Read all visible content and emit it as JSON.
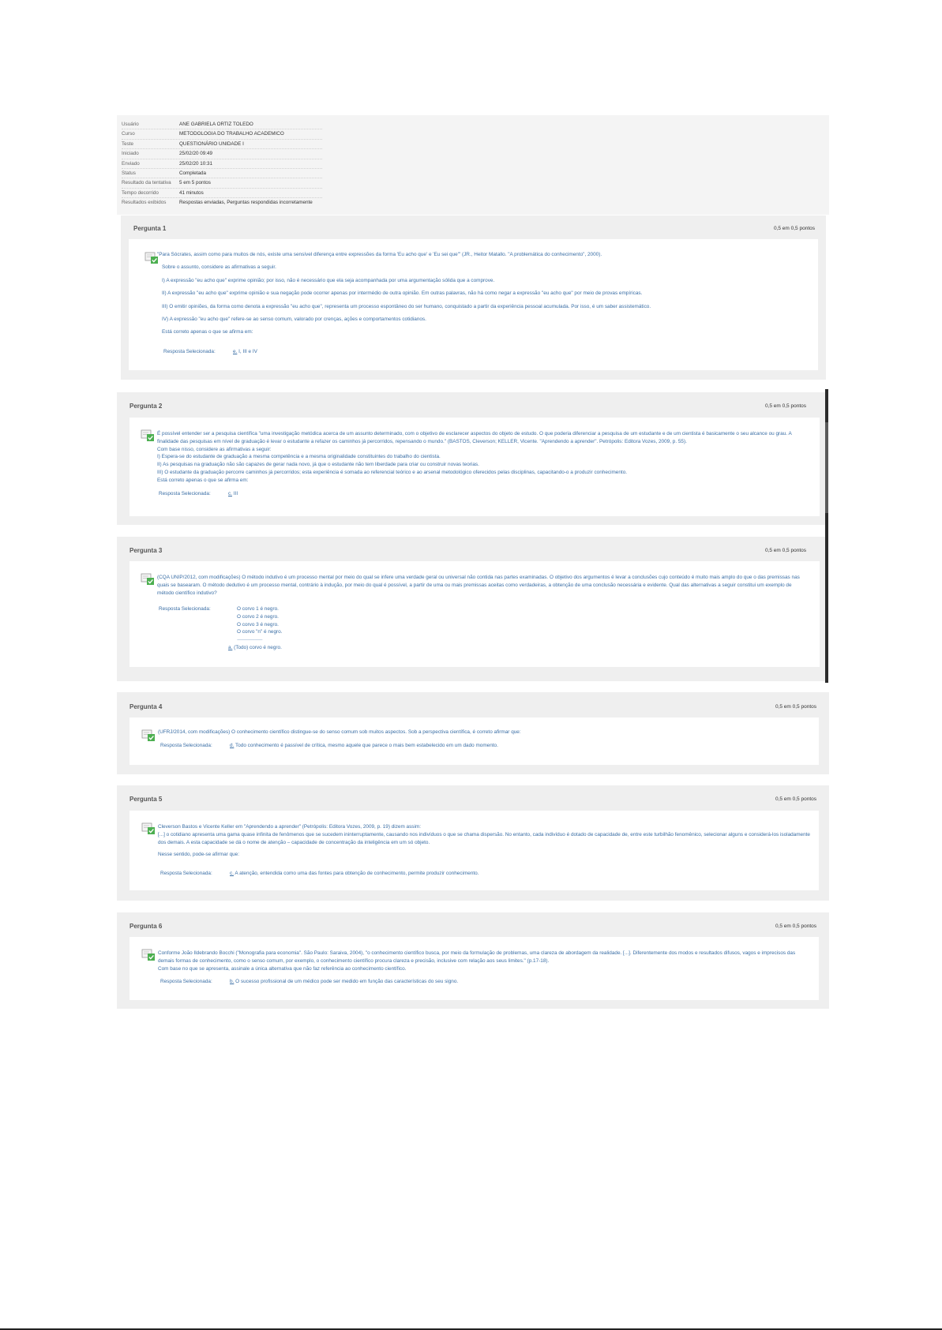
{
  "summary": {
    "rows": [
      {
        "label": "Usuário",
        "value": "ANE GABRIELA ORTIZ TOLEDO"
      },
      {
        "label": "Curso",
        "value": "METODOLOGIA DO TRABALHO ACADEMICO"
      },
      {
        "label": "Teste",
        "value": "QUESTIONÁRIO UNIDADE I"
      },
      {
        "label": "Iniciado",
        "value": "25/02/20 09:49"
      },
      {
        "label": "Enviado",
        "value": "25/02/20 10:31"
      },
      {
        "label": "Status",
        "value": "Completada"
      },
      {
        "label": "Resultado da tentativa",
        "value": "5 em 5 pontos"
      },
      {
        "label": "Tempo decorrido",
        "value": "41 minutos"
      },
      {
        "label": "Resultados exibidos",
        "value": "Respostas enviadas, Perguntas respondidas incorretamente"
      }
    ]
  },
  "answer_label": "Resposta Selecionada:",
  "questions": [
    {
      "title": "Pergunta 1",
      "points": "0,5 em 0,5 pontos",
      "lines": [
        "\"Para Sócrates, assim como para muitos de nós, existe uma sensível diferença entre expressões da forma 'Eu acho que' e 'Eu sei que'\" (JR., Heitor Matallo. \"A problemática do conhecimento\", 2000).",
        "Sobre o assunto, considere as afirmativas a seguir.",
        "I) A expressão \"eu acho que\" exprime opinião; por isso, não é necessário que ela seja acompanhada por uma argumentação sólida que a comprove.",
        "II) A expressão \"eu acho que\" exprime opinião e sua negação pode ocorrer apenas por intermédio de outra opinião. Em outras palavras, não há como negar a expressão \"eu acho que\" por meio de provas empíricas.",
        "III) O emitir opiniões, da forma como denota a expressão \"eu acho que\", representa um processo espontâneo do ser humano, conquistado a partir da experiência pessoal acumulada. Por isso, é um saber assistemático.",
        "IV) A expressão \"eu acho que\" refere-se ao senso comum, valorado por crenças, ações e comportamentos cotidianos.",
        "Está correto apenas o que se afirma em:"
      ],
      "answer_letter": "e.",
      "answer_lines": [
        "I, III e IV"
      ]
    },
    {
      "title": "Pergunta 2",
      "points": "0,5 em 0,5 pontos",
      "lines": [
        "É possível entender ser a pesquisa científica \"uma investigação metódica acerca de um assunto determinado, com o objetivo de esclarecer aspectos do objeto de estudo. O que poderia diferenciar a pesquisa de um estudante e de um cientista é basicamente o seu alcance ou grau. A finalidade das pesquisas em nível de graduação é levar o estudante a refazer os caminhos já percorridos, repensando o mundo.\" (BASTOS, Cleverson; KELLER, Vicente. \"Aprendendo a aprender\". Petrópolis: Editora Vozes, 2009, p. 55).",
        "Com base nisso, considere as afirmativas a seguir:",
        "I) Espera-se do estudante de graduação a mesma competência e a mesma originalidade constituintes do trabalho do cientista.",
        "II) As pesquisas na graduação não são capazes de gerar nada novo, já que o estudante não tem liberdade para criar ou construir novas teorias.",
        "III) O estudante da graduação percorre caminhos já percorridos; esta experiência é somada ao referencial teórico e ao arsenal metodológico oferecidos pelas disciplinas, capacitando-o a produzir conhecimento.",
        "Está correto apenas o que se afirma em:"
      ],
      "answer_letter": "c.",
      "answer_lines": [
        "III"
      ]
    },
    {
      "title": "Pergunta 3",
      "points": "0,5 em 0,5 pontos",
      "lines": [
        "(CQA UNIP/2012, com modificações) O método indutivo é um processo mental por meio do qual se infere uma verdade geral ou universal não contida nas partes examinadas. O objetivo dos argumentos é levar a conclusões cujo conteúdo é muito mais amplo do que o das premissas nas quais se basearam. O método dedutivo é um processo mental, contrário à indução, por meio do qual é possível, a partir de uma ou mais premissas aceitas como verdadeiras, a obtenção de uma conclusão necessária e evidente. Qual das alternativas a seguir constitui um exemplo de método científico indutivo?"
      ],
      "answer_letter": "a.",
      "answer_lines": [
        "O corvo 1 é negro.",
        "O corvo 2 é negro.",
        "O corvo 3 é negro.",
        "O corvo \"n\" é negro.",
        "----------------------------",
        "(Todo) corvo é negro."
      ]
    },
    {
      "title": "Pergunta 4",
      "points": "0,5 em 0,5 pontos",
      "lines": [
        "(UFRJ/2014, com modificações) O conhecimento científico distingue-se do senso comum sob muitos aspectos. Sob a perspectiva científica, é correto afirmar que:"
      ],
      "answer_letter": "d.",
      "answer_lines": [
        "Todo conhecimento é passível de crítica, mesmo aquele que parece o mais bem estabelecido em um dado momento."
      ]
    },
    {
      "title": "Pergunta 5",
      "points": "0,5 em 0,5 pontos",
      "lines": [
        "Cleverson Bastos e Vicente Keller em \"Aprendendo a aprender\" (Petrópolis: Editora Vozes, 2009, p. 19) dizem assim:",
        "[...] o cotidiano apresenta uma gama quase infinita de fenômenos que se sucedem ininterruptamente, causando nos indivíduos o que se chama dispersão. No entanto, cada indivíduo é dotado de capacidade de, entre este turbilhão fenomênico, selecionar alguns e considerá-los isoladamente dos demais. A esta capacidade se dá o nome de atenção – capacidade de concentração da inteligência em um só objeto.",
        "Nesse sentido, pode-se afirmar que:"
      ],
      "answer_letter": "c.",
      "answer_lines": [
        "A atenção, entendida como uma das fontes para obtenção de conhecimento, permite produzir conhecimento."
      ]
    },
    {
      "title": "Pergunta 6",
      "points": "0,5 em 0,5 pontos",
      "lines": [
        "Conforme João Ildebrando Bocchi (\"Monografia para economia\". São Paulo: Saraiva, 2004), \"o conhecimento científico busca, por meio da formulação de problemas, uma clareza de abordagem da realidade. [...]. Diferentemente dos modos e resultados difusos, vagos e imprecisos das demais formas de conhecimento, como o senso comum, por exemplo, o conhecimento científico procura clareza e precisão, inclusive com relação aos seus limites.\" (p.17-18).",
        "Com base no que se apresenta, assinale a única alternativa que não faz referência ao conhecimento científico."
      ],
      "answer_letter": "b.",
      "answer_lines": [
        "O sucesso profissional de um médico pode ser medido em função das características do seu signo."
      ]
    }
  ],
  "colors": {
    "link_blue": "#3a6ea5",
    "segment_gray": "#efefef",
    "check_green": "#4caf50"
  },
  "icons": {
    "correct": "correct-answer-check-icon"
  }
}
